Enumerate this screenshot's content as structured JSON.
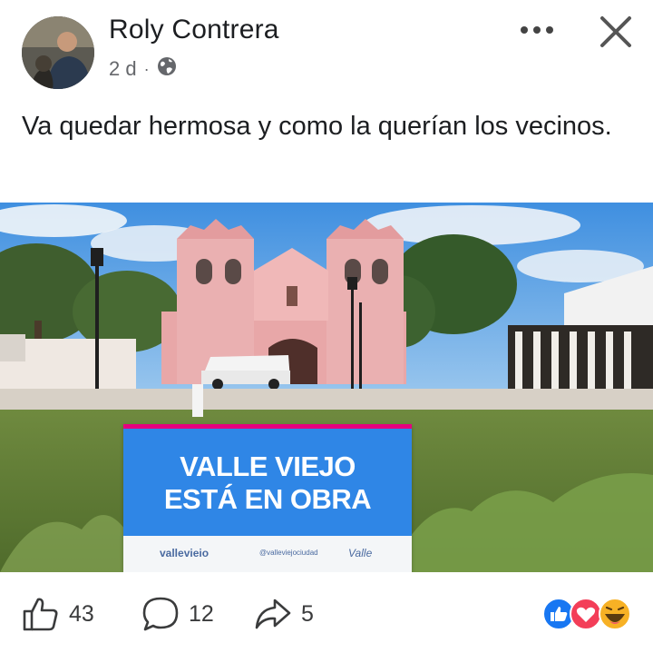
{
  "post": {
    "author": "Roly Contrera",
    "time": "2 d",
    "separator": "·",
    "audience_icon": "globe-icon",
    "text": "Va quedar hermosa y como la querían los vecinos."
  },
  "header_actions": {
    "more_icon": "more-horizontal-icon",
    "close_icon": "close-icon"
  },
  "photo": {
    "sign_line1": "VALLE VIEJO",
    "sign_line2": "ESTÁ EN OBRA",
    "sign_footer_left": "vallevieio",
    "sign_footer_mid": "@valleviejociudad",
    "sign_footer_right": "Valle"
  },
  "actions": {
    "like_count": "43",
    "comment_count": "12",
    "share_count": "5",
    "like_icon": "thumbs-up-icon",
    "comment_icon": "comment-icon",
    "share_icon": "share-arrow-icon"
  },
  "reactions": [
    "like-reaction-icon",
    "love-reaction-icon",
    "haha-reaction-icon"
  ],
  "colors": {
    "sign_blue": "#2f86e6",
    "church_pink": "#e8a7a8",
    "like_blue": "#1877f2",
    "love_red": "#f33e58",
    "haha_yellow": "#f7b125"
  }
}
